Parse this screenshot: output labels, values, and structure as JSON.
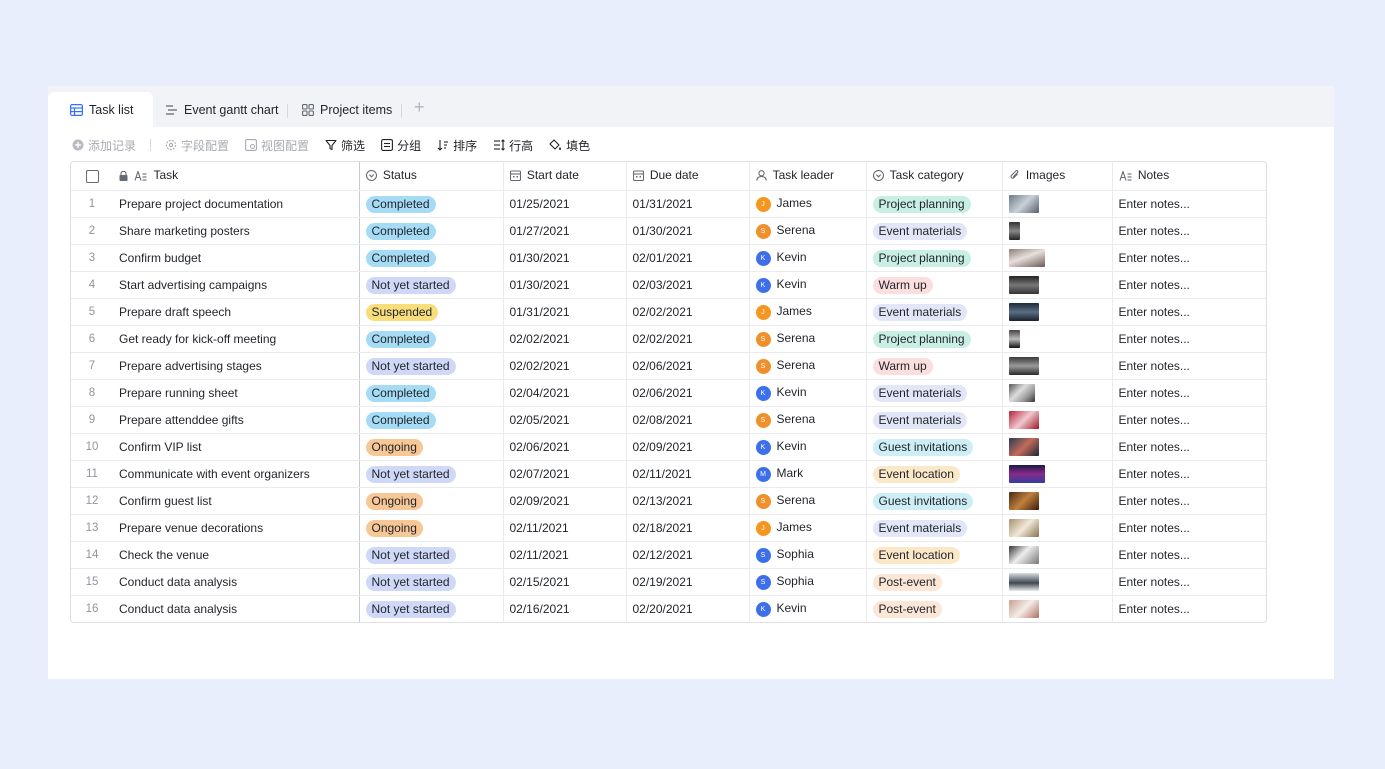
{
  "tabs": [
    {
      "label": "Task list",
      "icon": "table-icon",
      "active": true
    },
    {
      "label": "Event gantt chart",
      "icon": "gantt-icon",
      "active": false
    },
    {
      "label": "Project items",
      "icon": "grid-icon",
      "active": false
    }
  ],
  "toolbar": {
    "add_record": "添加记录",
    "field_config": "字段配置",
    "view_config": "视图配置",
    "filter": "筛选",
    "group": "分组",
    "sort": "排序",
    "row_height": "行高",
    "fill_color": "填色"
  },
  "columns": {
    "task": "Task",
    "status": "Status",
    "start": "Start date",
    "due": "Due date",
    "leader": "Task leader",
    "category": "Task category",
    "images": "Images",
    "notes": "Notes"
  },
  "colors": {
    "Completed": {
      "bg": "#a6dbf5",
      "fg": "#1f2329"
    },
    "Not yet started": {
      "bg": "#cfd8f6",
      "fg": "#1f2329"
    },
    "Suspended": {
      "bg": "#f8de7a",
      "fg": "#1f2329"
    },
    "Ongoing": {
      "bg": "#f8c796",
      "fg": "#1f2329"
    },
    "Project planning": {
      "bg": "#c9efe4",
      "fg": "#1f2329"
    },
    "Event materials": {
      "bg": "#e2e7f8",
      "fg": "#1f2329"
    },
    "Warm up": {
      "bg": "#fbdede",
      "fg": "#1f2329"
    },
    "Guest invitations": {
      "bg": "#cdeef4",
      "fg": "#1f2329"
    },
    "Event location": {
      "bg": "#fbe8c8",
      "fg": "#1f2329"
    },
    "Post-event": {
      "bg": "#fce6d6",
      "fg": "#1f2329"
    },
    "James": "#f5961f",
    "Serena": "#f0902b",
    "Kevin": "#3d6fea",
    "Mark": "#3d6fea",
    "Sophia": "#3d6fea"
  },
  "rows": [
    {
      "no": "1",
      "task": "Prepare project documentation",
      "status": "Completed",
      "start": "01/25/2021",
      "due": "01/31/2021",
      "leader": "James",
      "initial": "J",
      "category": "Project planning",
      "notes": "Enter notes..."
    },
    {
      "no": "2",
      "task": "Share marketing posters",
      "status": "Completed",
      "start": "01/27/2021",
      "due": "01/30/2021",
      "leader": "Serena",
      "initial": "S",
      "category": "Event materials",
      "notes": "Enter notes..."
    },
    {
      "no": "3",
      "task": "Confirm budget",
      "status": "Completed",
      "start": "01/30/2021",
      "due": "02/01/2021",
      "leader": "Kevin",
      "initial": "K",
      "category": "Project planning",
      "notes": "Enter notes..."
    },
    {
      "no": "4",
      "task": "Start advertising campaigns",
      "status": "Not yet started",
      "start": "01/30/2021",
      "due": "02/03/2021",
      "leader": "Kevin",
      "initial": "K",
      "category": "Warm up",
      "notes": "Enter notes..."
    },
    {
      "no": "5",
      "task": "Prepare draft speech",
      "status": "Suspended",
      "start": "01/31/2021",
      "due": "02/02/2021",
      "leader": "James",
      "initial": "J",
      "category": "Event materials",
      "notes": "Enter notes..."
    },
    {
      "no": "6",
      "task": "Get ready for kick-off meeting",
      "status": "Completed",
      "start": "02/02/2021",
      "due": "02/02/2021",
      "leader": "Serena",
      "initial": "S",
      "category": "Project planning",
      "notes": "Enter notes..."
    },
    {
      "no": "7",
      "task": "Prepare advertising stages",
      "status": "Not yet started",
      "start": "02/02/2021",
      "due": "02/06/2021",
      "leader": "Serena",
      "initial": "S",
      "category": "Warm up",
      "notes": "Enter notes..."
    },
    {
      "no": "8",
      "task": "Prepare running sheet",
      "status": "Completed",
      "start": "02/04/2021",
      "due": "02/06/2021",
      "leader": "Kevin",
      "initial": "K",
      "category": "Event materials",
      "notes": "Enter notes..."
    },
    {
      "no": "9",
      "task": "Prepare attenddee gifts",
      "status": "Completed",
      "start": "02/05/2021",
      "due": "02/08/2021",
      "leader": "Serena",
      "initial": "S",
      "category": "Event materials",
      "notes": "Enter notes..."
    },
    {
      "no": "10",
      "task": "Confirm VIP list",
      "status": "Ongoing",
      "start": "02/06/2021",
      "due": "02/09/2021",
      "leader": "Kevin",
      "initial": "K",
      "category": "Guest invitations",
      "notes": "Enter notes..."
    },
    {
      "no": "11",
      "task": "Communicate with event organizers",
      "status": "Not yet started",
      "start": "02/07/2021",
      "due": "02/11/2021",
      "leader": "Mark",
      "initial": "M",
      "category": "Event location",
      "notes": "Enter notes..."
    },
    {
      "no": "12",
      "task": "Confirm guest list",
      "status": "Ongoing",
      "start": "02/09/2021",
      "due": "02/13/2021",
      "leader": "Serena",
      "initial": "S",
      "category": "Guest invitations",
      "notes": "Enter notes..."
    },
    {
      "no": "13",
      "task": "Prepare venue decorations",
      "status": "Ongoing",
      "start": "02/11/2021",
      "due": "02/18/2021",
      "leader": "James",
      "initial": "J",
      "category": "Event materials",
      "notes": "Enter notes..."
    },
    {
      "no": "14",
      "task": "Check the venue",
      "status": "Not yet started",
      "start": "02/11/2021",
      "due": "02/12/2021",
      "leader": "Sophia",
      "initial": "S",
      "category": "Event location",
      "notes": "Enter notes..."
    },
    {
      "no": "15",
      "task": "Conduct data analysis",
      "status": "Not yet started",
      "start": "02/15/2021",
      "due": "02/19/2021",
      "leader": "Sophia",
      "initial": "S",
      "category": "Post-event",
      "notes": "Enter notes..."
    },
    {
      "no": "16",
      "task": "Conduct data analysis",
      "status": "Not yet started",
      "start": "02/16/2021",
      "due": "02/20/2021",
      "leader": "Kevin",
      "initial": "K",
      "category": "Post-event",
      "notes": "Enter notes..."
    }
  ]
}
